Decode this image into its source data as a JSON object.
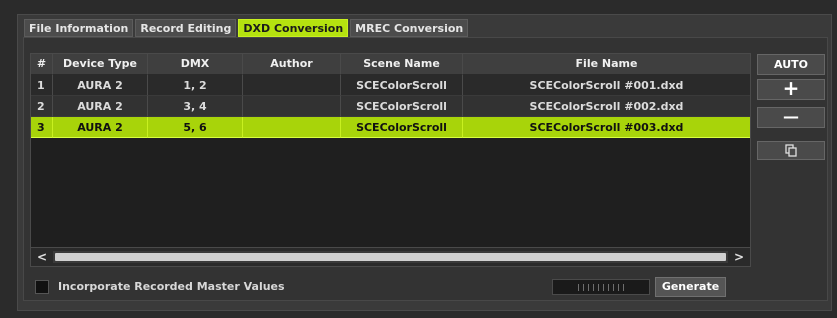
{
  "tabs": [
    {
      "label": "File Information"
    },
    {
      "label": "Record Editing"
    },
    {
      "label": "DXD Conversion"
    },
    {
      "label": "MREC Conversion"
    }
  ],
  "active_tab": "DXD Conversion",
  "table": {
    "headers": [
      "#",
      "Device Type",
      "DMX",
      "Author",
      "Scene Name",
      "File Name"
    ],
    "rows": [
      [
        "1",
        "AURA 2",
        "1, 2",
        "",
        "SCEColorScroll",
        "SCEColorScroll #001.dxd"
      ],
      [
        "2",
        "AURA 2",
        "3, 4",
        "",
        "SCEColorScroll",
        "SCEColorScroll #002.dxd"
      ],
      [
        "3",
        "AURA 2",
        "5, 6",
        "",
        "SCEColorScroll",
        "SCEColorScroll #003.dxd"
      ]
    ],
    "selected_row": 3
  },
  "side_buttons": {
    "auto": "AUTO",
    "add": "+",
    "remove": "—",
    "copy_icon": "copy-icon"
  },
  "scrollbar": {
    "left_arrow": "<",
    "right_arrow": ">"
  },
  "incorporate_label": "Incorporate Recorded Master Values",
  "incorporate_checked": false,
  "generate_label": "Generate",
  "colors": {
    "accent": "#b5e20f",
    "background": "#2b2b2b"
  }
}
